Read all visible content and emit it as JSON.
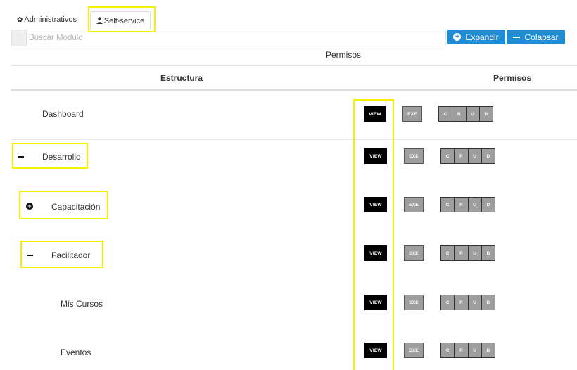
{
  "tabs": {
    "administrativos": {
      "icon": "gear-icon",
      "label": "Administrativos"
    },
    "self_service": {
      "icon": "user-icon",
      "label": "Self-service"
    }
  },
  "search": {
    "placeholder": "Buscar Modulo",
    "value": ""
  },
  "buttons": {
    "expand": {
      "icon": "plus-circle-icon",
      "label": "Expandir"
    },
    "collapse": {
      "icon": "minus-icon",
      "label": "Colapsar"
    }
  },
  "caption": "Permisos",
  "table": {
    "headers": {
      "estructura": "Estructura",
      "permisos": "Permisos"
    },
    "rows": [
      {
        "label": "Dashboard",
        "toggle": ""
      },
      {
        "label": "Desarrollo",
        "toggle": "minus"
      },
      {
        "label": "Capacitación",
        "toggle": "plus"
      },
      {
        "label": "Facilitador",
        "toggle": "minus"
      },
      {
        "label": "Mis Cursos",
        "toggle": ""
      },
      {
        "label": "Eventos",
        "toggle": ""
      }
    ],
    "permission_labels": {
      "view": "VIEW",
      "exe": "EXE",
      "c": "C",
      "r": "R",
      "u": "U",
      "d": "D"
    }
  },
  "colors": {
    "primary": "#1f8dd6",
    "view_active": "#000000",
    "inactive": "#9e9e9e",
    "highlight": "#f4f000"
  }
}
